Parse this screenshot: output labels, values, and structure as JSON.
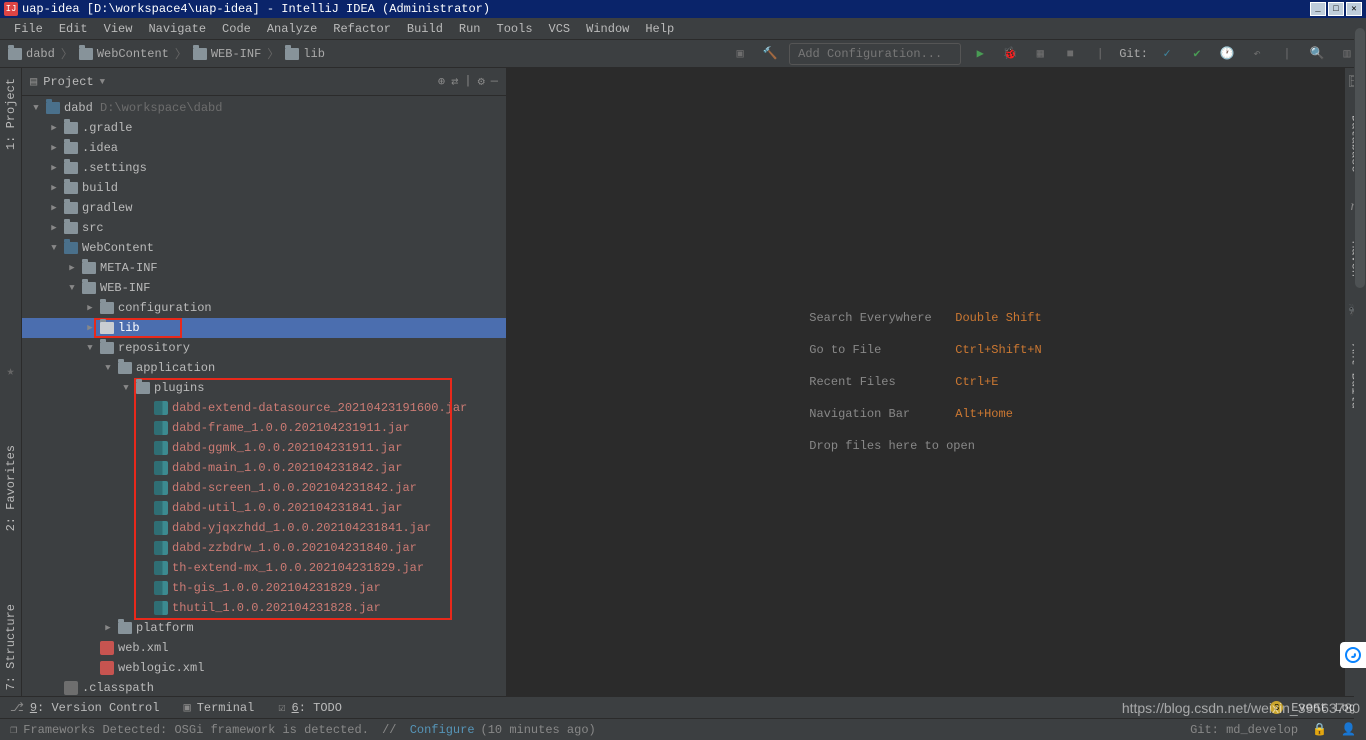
{
  "title": "uap-idea [D:\\workspace4\\uap-idea] - IntelliJ IDEA (Administrator)",
  "menu": [
    "File",
    "Edit",
    "View",
    "Navigate",
    "Code",
    "Analyze",
    "Refactor",
    "Build",
    "Run",
    "Tools",
    "VCS",
    "Window",
    "Help"
  ],
  "breadcrumbs": [
    "dabd",
    "WebContent",
    "WEB-INF",
    "lib"
  ],
  "addConfig": "Add Configuration...",
  "gitLabel": "Git:",
  "sidebar": {
    "title": "Project",
    "root": {
      "name": "dabd",
      "path": "D:\\workspace\\dabd"
    },
    "folders": {
      "gradle": ".gradle",
      "idea": ".idea",
      "settings": ".settings",
      "build": "build",
      "gradlew": "gradlew",
      "src": "src",
      "webcontent": "WebContent",
      "metainf": "META-INF",
      "webinf": "WEB-INF",
      "configuration": "configuration",
      "lib": "lib",
      "repository": "repository",
      "application": "application",
      "plugins": "plugins",
      "platform": "platform",
      "webxml": "web.xml",
      "weblogic": "weblogic.xml",
      "classpath": ".classpath"
    },
    "jars": [
      "dabd-extend-datasource_20210423191600.jar",
      "dabd-frame_1.0.0.202104231911.jar",
      "dabd-ggmk_1.0.0.202104231911.jar",
      "dabd-main_1.0.0.202104231842.jar",
      "dabd-screen_1.0.0.202104231842.jar",
      "dabd-util_1.0.0.202104231841.jar",
      "dabd-yjqxzhdd_1.0.0.202104231841.jar",
      "dabd-zzbdrw_1.0.0.202104231840.jar",
      "th-extend-mx_1.0.0.202104231829.jar",
      "th-gis_1.0.0.202104231829.jar",
      "thutil_1.0.0.202104231828.jar"
    ]
  },
  "leftTabs": {
    "project": "1: Project",
    "favorites": "2: Favorites",
    "structure": "7: Structure"
  },
  "rightTabs": {
    "database": "Database",
    "maven": "Maven",
    "ant": "Ant Build"
  },
  "hints": {
    "search": {
      "label": "Search Everywhere",
      "key": "Double Shift"
    },
    "gotofile": {
      "label": "Go to File",
      "key": "Ctrl+Shift+N"
    },
    "recent": {
      "label": "Recent Files",
      "key": "Ctrl+E"
    },
    "navbar": {
      "label": "Navigation Bar",
      "key": "Alt+Home"
    },
    "drop": {
      "label": "Drop files here to open"
    }
  },
  "bottom": {
    "versionControl": "9: Version Control",
    "terminal": "Terminal",
    "todo": "6: TODO",
    "eventLog": "Event Log",
    "eventCount": "3"
  },
  "status": {
    "text": "Frameworks Detected: OSGi framework is detected.",
    "configure": "Configure",
    "ago": "(10 minutes ago)",
    "git": "Git: md_develop"
  },
  "watermark": "https://blog.csdn.net/weixin_39563780"
}
